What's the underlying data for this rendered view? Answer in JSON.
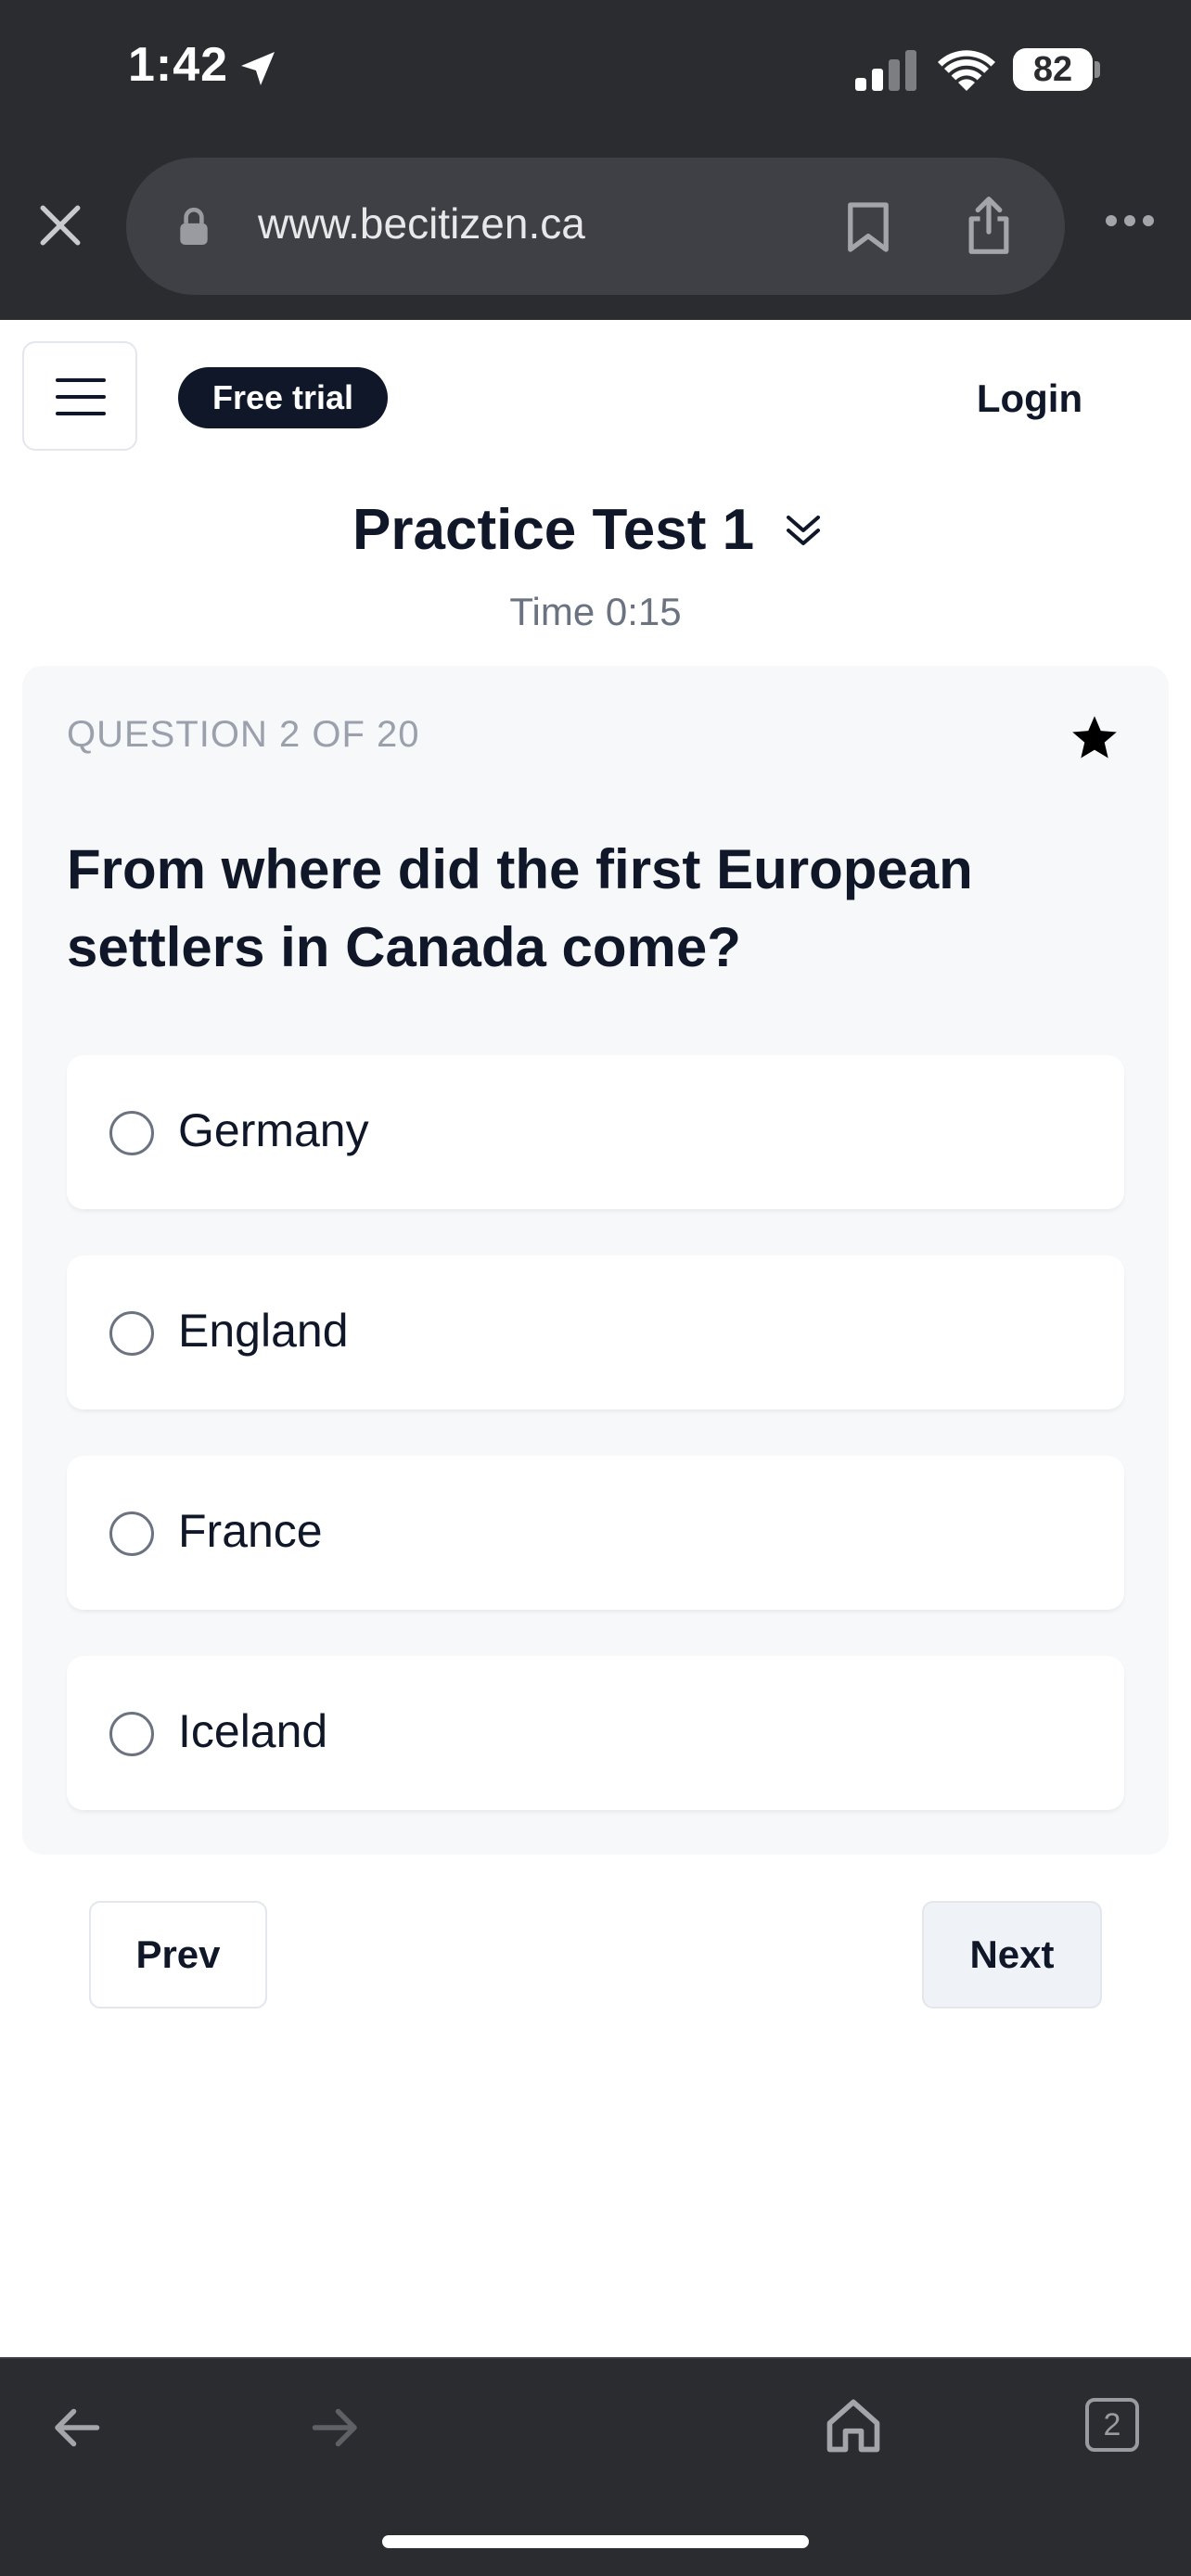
{
  "status_bar": {
    "time": "1:42",
    "battery": "82",
    "icons": [
      "location-arrow-icon",
      "signal-icon",
      "wifi-icon",
      "battery-icon"
    ]
  },
  "browser": {
    "url": "www.becitizen.ca",
    "tab_count": "2",
    "icons": [
      "close-icon",
      "lock-icon",
      "bookmark-icon",
      "share-icon",
      "more-icon",
      "back-icon",
      "forward-icon",
      "home-icon",
      "tabs-icon"
    ]
  },
  "header": {
    "free_trial": "Free trial",
    "login": "Login"
  },
  "test": {
    "title": "Practice Test 1",
    "timer": "Time 0:15"
  },
  "question": {
    "counter": "QUESTION 2 OF 20",
    "text": "From where did the first European settlers in Canada come?",
    "options": [
      {
        "label": "Germany"
      },
      {
        "label": "England"
      },
      {
        "label": "France"
      },
      {
        "label": "Iceland"
      }
    ]
  },
  "navigation": {
    "prev": "Prev",
    "next": "Next"
  },
  "colors": {
    "chrome": "#2b2c30",
    "primary_dark": "#0f1729",
    "card_bg": "#f7f8fa",
    "muted": "#9aa1ad"
  }
}
